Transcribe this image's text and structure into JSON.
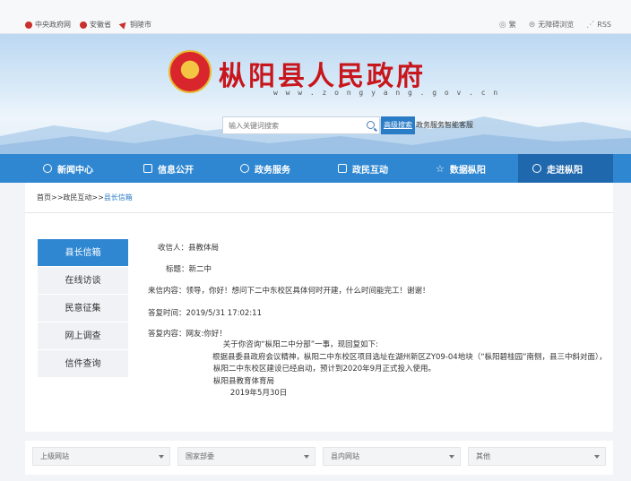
{
  "topbar": {
    "links": [
      "中央政府网",
      "安徽省",
      "铜陵市"
    ],
    "tools": [
      "繁",
      "无障碍浏览",
      "RSS"
    ]
  },
  "header": {
    "title": "枞阳县人民政府",
    "url": "w w w . z o n g y a n g . g o v . c n",
    "search_placeholder": "输入关键词搜索",
    "advanced_search": "高级搜索",
    "smart_service": "政务服务智能客服"
  },
  "nav": {
    "items": [
      "新闻中心",
      "信息公开",
      "政务服务",
      "政民互动",
      "数据枞阳",
      "走进枞阳"
    ],
    "active_index": 5
  },
  "breadcrumb": {
    "path": "首页>>政民互动>>",
    "current": "县长信箱"
  },
  "sidemenu": {
    "items": [
      "县长信箱",
      "在线访谈",
      "民意征集",
      "网上调查",
      "信件查询"
    ],
    "active_index": 0
  },
  "letter": {
    "recipient_label": "收信人：",
    "recipient": "县教体局",
    "subject_label": "标题：",
    "subject": "新二中",
    "content_label": "来信内容：",
    "content": "领导，你好！想问下二中东校区具体何时开建，什么时间能完工！谢谢！",
    "reply_time_label": "答复时间：",
    "reply_time": "2019/5/31 17:02:11",
    "reply_label": "答复内容：",
    "reply_lines": [
      "网友:你好！",
      "    关于你咨询“枞阳二中分部”一事，现回复如下:",
      "根据县委县政府会议精神，枞阳二中东校区项目选址在湖州新区ZY09-04地块（“枞阳碧桂园”南侧，县三中斜对面），",
      "枞阳二中东校区建设已经启动，预计到2020年9月正式投入使用。",
      "枞阳县教育体育局",
      "       2019年5月30日"
    ]
  },
  "footer": {
    "selects": [
      "上级网站",
      "国家部委",
      "县内网站",
      "其他"
    ]
  }
}
